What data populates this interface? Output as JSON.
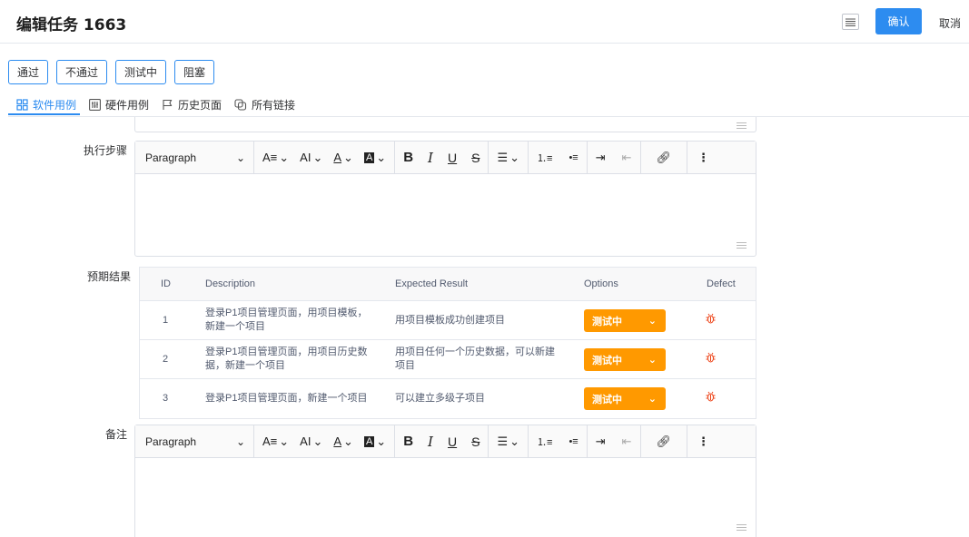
{
  "header": {
    "title": "编辑任务 1663",
    "confirm_label": "确认",
    "cancel_label": "取消"
  },
  "status_buttons": [
    "通过",
    "不通过",
    "测试中",
    "阻塞"
  ],
  "tabs": [
    {
      "label": "软件用例",
      "icon": "grid-icon",
      "active": true
    },
    {
      "label": "硬件用例",
      "icon": "sliders-icon",
      "active": false
    },
    {
      "label": "历史页面",
      "icon": "flag-icon",
      "active": false
    },
    {
      "label": "所有链接",
      "icon": "copy-icon",
      "active": false
    }
  ],
  "fields": {
    "steps_label": "执行步骤",
    "expected_label": "预期结果",
    "notes_label": "备注"
  },
  "editor_toolbar": {
    "paragraph": "Paragraph"
  },
  "table": {
    "headers": [
      "ID",
      "Description",
      "Expected Result",
      "Options",
      "Defect"
    ],
    "rows": [
      {
        "id": "1",
        "desc1": "登录P1项目管理页面，用项目模板，",
        "desc2": "新建一个项目",
        "exp1": "用项目模板成功创建项目",
        "exp2": "",
        "option": "测试中"
      },
      {
        "id": "2",
        "desc1": "登录P1项目管理页面，用项目历史数",
        "desc2": "据，新建一个项目",
        "exp1": "用项目任何一个历史数据，可以新建",
        "exp2": "项目",
        "option": "测试中"
      },
      {
        "id": "3",
        "desc1": "登录P1项目管理页面，新建一个项目",
        "desc2": "",
        "exp1": "可以建立多级子项目",
        "exp2": "",
        "option": "测试中"
      }
    ]
  },
  "colors": {
    "accent": "#2d8cf0",
    "option_bg": "#ff9900",
    "defect_icon": "#ed4014"
  }
}
